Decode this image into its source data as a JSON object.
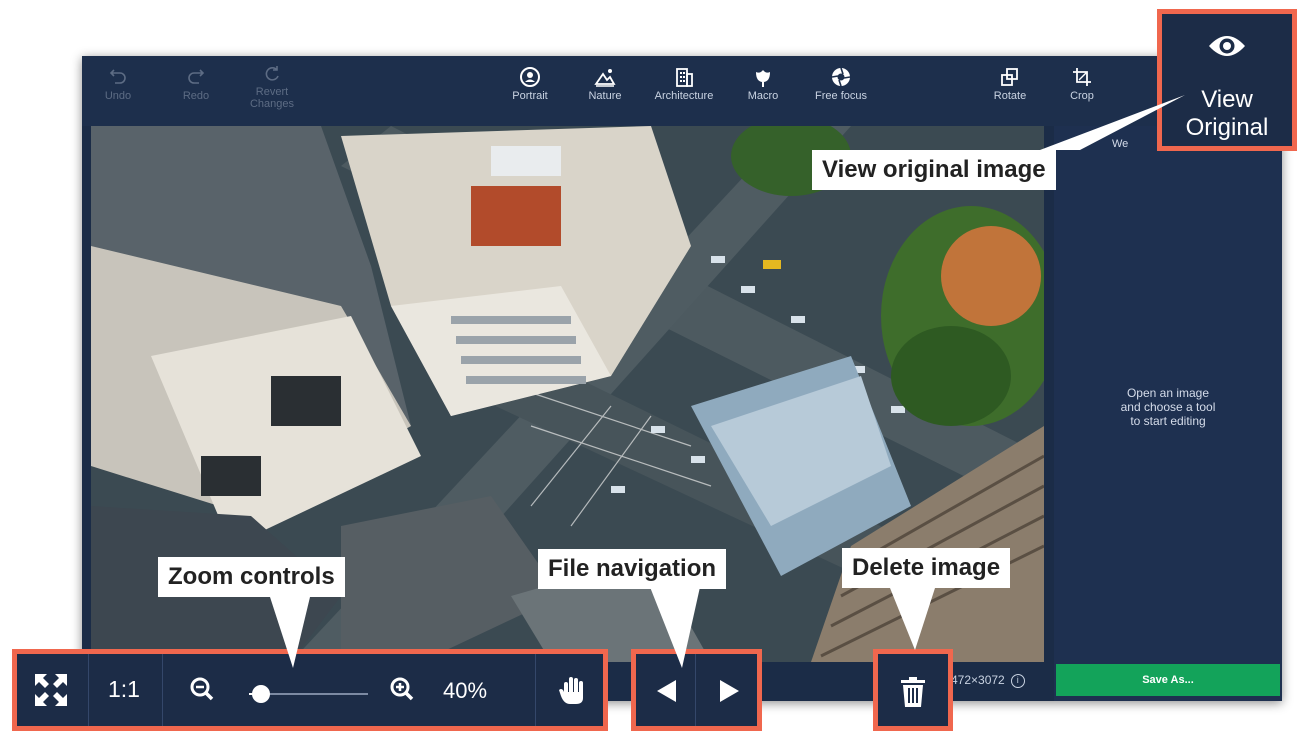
{
  "toolbar": {
    "undo": "Undo",
    "redo": "Redo",
    "revert_line1": "Revert",
    "revert_line2": "Changes",
    "portrait": "Portrait",
    "nature": "Nature",
    "architecture": "Architecture",
    "macro": "Macro",
    "free_focus": "Free focus",
    "rotate": "Rotate",
    "crop": "Crop"
  },
  "side_panel": {
    "hint": "Open an image\nand choose a tool\nto start editing",
    "partial_text": "We",
    "save_as": "Save As..."
  },
  "status": {
    "dimensions": "472×3072",
    "info_icon": "info-icon"
  },
  "zoom": {
    "fit_icon": "fit-to-screen-icon",
    "one_to_one": "1:1",
    "zoom_out_icon": "zoom-out-icon",
    "zoom_in_icon": "zoom-in-icon",
    "slider_fraction": 0.1,
    "percent": "40%",
    "hand_icon": "hand-pan-icon"
  },
  "navigation": {
    "prev_icon": "triangle-left-icon",
    "next_icon": "triangle-right-icon"
  },
  "delete": {
    "icon": "trash-icon"
  },
  "view_original": {
    "icon": "eye-icon",
    "label": "View\nOriginal"
  },
  "callouts": {
    "view_original": "View original image",
    "zoom_controls": "Zoom controls",
    "file_navigation": "File navigation",
    "delete_image": "Delete image"
  },
  "colors": {
    "accent_box": "#f0674e",
    "save_button": "#13a35a",
    "app_background": "#1b2c47"
  }
}
